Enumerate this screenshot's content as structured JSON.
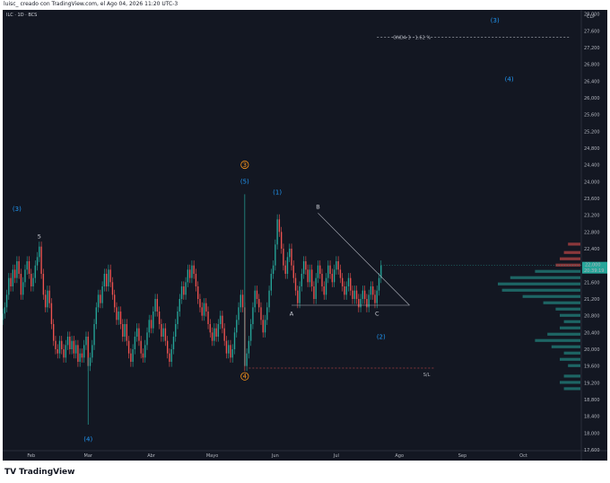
{
  "header": {
    "caption": "luisc_ creado con TradingView.com, el Ago 04, 2026 11:20 UTC-3"
  },
  "symbol_line": "ILC · 1D · BCS",
  "currency": "CLP",
  "footer": {
    "brand": "TradingView",
    "brand_mark": "TV"
  },
  "colors": {
    "background": "#131722",
    "up_candle": "#26a69a",
    "down_candle": "#ef5350",
    "wave_blue": "#2196f3",
    "wave_orange": "#f7931a",
    "annotation_gray": "#b2b5be",
    "volume_profile_up": "#26a69a",
    "volume_profile_down": "#ef5350"
  },
  "price_marker": {
    "value": "22,000",
    "countdown": "20:39:19"
  },
  "chart_data": {
    "type": "candlestick",
    "symbol": "ILC",
    "interval": "1D",
    "x_labels": [
      "Feb",
      "Mar",
      "Abr",
      "Mayo",
      "Jun",
      "Jul",
      "Ago",
      "Sep",
      "Oct"
    ],
    "x_label_days": [
      0,
      28,
      59,
      89,
      120,
      150,
      181,
      212,
      242
    ],
    "x_range": [
      -14,
      270
    ],
    "y_ticks": [
      17600,
      18000,
      18400,
      18800,
      19200,
      19600,
      20000,
      20400,
      20800,
      21200,
      21600,
      22000,
      22400,
      22800,
      23200,
      23600,
      24000,
      24400,
      24800,
      25200,
      25600,
      26000,
      26400,
      26800,
      27200,
      27600,
      28000
    ],
    "y_range": [
      17600,
      28100
    ],
    "closes": [
      [
        -14,
        20850
      ],
      [
        -13,
        21000
      ],
      [
        -12,
        21300
      ],
      [
        -11,
        21700
      ],
      [
        -10,
        21500
      ],
      [
        -9,
        21900
      ],
      [
        -8,
        21700
      ],
      [
        -7,
        22100
      ],
      [
        -6,
        21800
      ],
      [
        -5,
        21300
      ],
      [
        -4,
        21600
      ],
      [
        -3,
        21900
      ],
      [
        -2,
        22100
      ],
      [
        -1,
        21800
      ],
      [
        0,
        21500
      ],
      [
        1,
        21700
      ],
      [
        2,
        22000
      ],
      [
        3,
        22200
      ],
      [
        4,
        22450
      ],
      [
        5,
        21800
      ],
      [
        6,
        21300
      ],
      [
        7,
        21000
      ],
      [
        8,
        21400
      ],
      [
        9,
        21100
      ],
      [
        10,
        20600
      ],
      [
        11,
        20200
      ],
      [
        12,
        20000
      ],
      [
        13,
        19900
      ],
      [
        14,
        20200
      ],
      [
        15,
        20000
      ],
      [
        16,
        19800
      ],
      [
        17,
        20100
      ],
      [
        18,
        20300
      ],
      [
        19,
        20000
      ],
      [
        20,
        20200
      ],
      [
        21,
        19900
      ],
      [
        22,
        20100
      ],
      [
        23,
        19700
      ],
      [
        24,
        19900
      ],
      [
        25,
        19800
      ],
      [
        26,
        20100
      ],
      [
        27,
        20300
      ],
      [
        28,
        19600
      ],
      [
        29,
        19800
      ],
      [
        30,
        20100
      ],
      [
        31,
        20600
      ],
      [
        32,
        21000
      ],
      [
        33,
        21300
      ],
      [
        34,
        21100
      ],
      [
        35,
        21500
      ],
      [
        36,
        21800
      ],
      [
        37,
        21500
      ],
      [
        38,
        21900
      ],
      [
        39,
        21600
      ],
      [
        40,
        21300
      ],
      [
        41,
        21000
      ],
      [
        42,
        20700
      ],
      [
        43,
        20900
      ],
      [
        44,
        20600
      ],
      [
        45,
        20300
      ],
      [
        46,
        20600
      ],
      [
        47,
        20200
      ],
      [
        48,
        19900
      ],
      [
        49,
        19700
      ],
      [
        50,
        20000
      ],
      [
        51,
        20300
      ],
      [
        52,
        20500
      ],
      [
        53,
        20200
      ],
      [
        54,
        19900
      ],
      [
        55,
        19800
      ],
      [
        56,
        20100
      ],
      [
        57,
        20400
      ],
      [
        58,
        20700
      ],
      [
        59,
        20500
      ],
      [
        60,
        20900
      ],
      [
        61,
        21200
      ],
      [
        62,
        20900
      ],
      [
        63,
        20600
      ],
      [
        64,
        20300
      ],
      [
        65,
        20500
      ],
      [
        66,
        20200
      ],
      [
        67,
        19900
      ],
      [
        68,
        19700
      ],
      [
        69,
        20000
      ],
      [
        70,
        20300
      ],
      [
        71,
        20600
      ],
      [
        72,
        20900
      ],
      [
        73,
        21200
      ],
      [
        74,
        21500
      ],
      [
        75,
        21300
      ],
      [
        76,
        21600
      ],
      [
        77,
        21900
      ],
      [
        78,
        21700
      ],
      [
        79,
        22000
      ],
      [
        80,
        21800
      ],
      [
        81,
        21500
      ],
      [
        82,
        21200
      ],
      [
        83,
        21000
      ],
      [
        84,
        20800
      ],
      [
        85,
        21100
      ],
      [
        86,
        20900
      ],
      [
        87,
        20600
      ],
      [
        88,
        20400
      ],
      [
        89,
        20200
      ],
      [
        90,
        20500
      ],
      [
        91,
        20300
      ],
      [
        92,
        20600
      ],
      [
        93,
        20800
      ],
      [
        94,
        20500
      ],
      [
        95,
        20200
      ],
      [
        96,
        19900
      ],
      [
        97,
        20100
      ],
      [
        98,
        19800
      ],
      [
        99,
        20000
      ],
      [
        100,
        20400
      ],
      [
        101,
        20700
      ],
      [
        102,
        21000
      ],
      [
        103,
        21300
      ],
      [
        104,
        21000
      ],
      [
        105,
        19600
      ],
      [
        106,
        19900
      ],
      [
        107,
        20200
      ],
      [
        108,
        20600
      ],
      [
        109,
        21000
      ],
      [
        110,
        21400
      ],
      [
        111,
        21200
      ],
      [
        112,
        21000
      ],
      [
        113,
        20700
      ],
      [
        114,
        20400
      ],
      [
        115,
        20700
      ],
      [
        116,
        21000
      ],
      [
        117,
        21400
      ],
      [
        118,
        21800
      ],
      [
        119,
        22000
      ],
      [
        120,
        22500
      ],
      [
        121,
        23100
      ],
      [
        122,
        22800
      ],
      [
        123,
        22400
      ],
      [
        124,
        22000
      ],
      [
        125,
        21800
      ],
      [
        126,
        22200
      ],
      [
        127,
        22400
      ],
      [
        128,
        22000
      ],
      [
        129,
        21700
      ],
      [
        130,
        21400
      ],
      [
        131,
        21100
      ],
      [
        132,
        21500
      ],
      [
        133,
        21800
      ],
      [
        134,
        22100
      ],
      [
        135,
        21900
      ],
      [
        136,
        21600
      ],
      [
        137,
        21900
      ],
      [
        138,
        21500
      ],
      [
        139,
        21200
      ],
      [
        140,
        21700
      ],
      [
        141,
        22000
      ],
      [
        142,
        21800
      ],
      [
        143,
        21500
      ],
      [
        144,
        21300
      ],
      [
        145,
        21700
      ],
      [
        146,
        22000
      ],
      [
        147,
        21800
      ],
      [
        148,
        21600
      ],
      [
        149,
        21900
      ],
      [
        150,
        22100
      ],
      [
        151,
        21900
      ],
      [
        152,
        21700
      ],
      [
        153,
        21500
      ],
      [
        154,
        21300
      ],
      [
        155,
        21500
      ],
      [
        156,
        21700
      ],
      [
        157,
        21400
      ],
      [
        158,
        21200
      ],
      [
        159,
        21400
      ],
      [
        160,
        21200
      ],
      [
        161,
        21000
      ],
      [
        162,
        21200
      ],
      [
        163,
        21400
      ],
      [
        164,
        21200
      ],
      [
        165,
        21000
      ],
      [
        166,
        21300
      ],
      [
        167,
        21500
      ],
      [
        168,
        21300
      ],
      [
        169,
        21100
      ],
      [
        170,
        21400
      ],
      [
        171,
        21700
      ],
      [
        172,
        22000
      ]
    ],
    "wave_labels": [
      {
        "text": "(3)",
        "day": -7,
        "price": 23300,
        "color": "#2196f3"
      },
      {
        "text": "(3)",
        "day": 228,
        "price": 27800,
        "color": "#2196f3"
      },
      {
        "text": "(4)",
        "day": 28,
        "price": 17800,
        "color": "#2196f3"
      },
      {
        "text": "(4)",
        "day": 235,
        "price": 26400,
        "color": "#2196f3"
      },
      {
        "text": "(5)",
        "day": 105,
        "price": 23950,
        "color": "#2196f3"
      },
      {
        "text": "(1)",
        "day": 121,
        "price": 23700,
        "color": "#2196f3"
      },
      {
        "text": "(2)",
        "day": 172,
        "price": 20250,
        "color": "#2196f3"
      },
      {
        "text": "3",
        "day": 105,
        "price": 24350,
        "color": "#f7931a",
        "circled": true
      },
      {
        "text": "4",
        "day": 105,
        "price": 19300,
        "color": "#f7931a",
        "circled": true
      }
    ],
    "wave_letters": [
      {
        "text": "5",
        "day": 4,
        "price": 22650
      },
      {
        "text": "B",
        "day": 141,
        "price": 23350
      },
      {
        "text": "A",
        "day": 128,
        "price": 20800
      },
      {
        "text": "C",
        "day": 170,
        "price": 20800
      }
    ],
    "triangle": {
      "apex_top": [
        141,
        23250
      ],
      "right_end": [
        186,
        21050
      ],
      "base_left": [
        128,
        21050
      ]
    },
    "horizontal_annotations": [
      {
        "label": "ONDA 3 · 1.62 %",
        "price": 27450,
        "from_day": 170,
        "to_day": 265
      },
      {
        "label": "S/L",
        "price": 19550,
        "from_day": 107,
        "to_day": 198
      }
    ],
    "volume_profile": [
      [
        22500,
        0.15,
        "down"
      ],
      [
        22300,
        0.2,
        "down"
      ],
      [
        22150,
        0.25,
        "down"
      ],
      [
        22000,
        0.3,
        "down"
      ],
      [
        21850,
        0.55,
        "up"
      ],
      [
        21700,
        0.85,
        "up"
      ],
      [
        21550,
        1.0,
        "up"
      ],
      [
        21400,
        0.95,
        "up"
      ],
      [
        21250,
        0.7,
        "up"
      ],
      [
        21100,
        0.45,
        "up"
      ],
      [
        20950,
        0.3,
        "up"
      ],
      [
        20800,
        0.25,
        "up"
      ],
      [
        20650,
        0.2,
        "up"
      ],
      [
        20500,
        0.25,
        "up"
      ],
      [
        20350,
        0.4,
        "up"
      ],
      [
        20200,
        0.55,
        "up"
      ],
      [
        20050,
        0.35,
        "up"
      ],
      [
        19900,
        0.2,
        "up"
      ],
      [
        19750,
        0.25,
        "up"
      ],
      [
        19600,
        0.15,
        "up"
      ],
      [
        19350,
        0.2,
        "up"
      ],
      [
        19200,
        0.25,
        "up"
      ],
      [
        19050,
        0.2,
        "up"
      ]
    ]
  }
}
